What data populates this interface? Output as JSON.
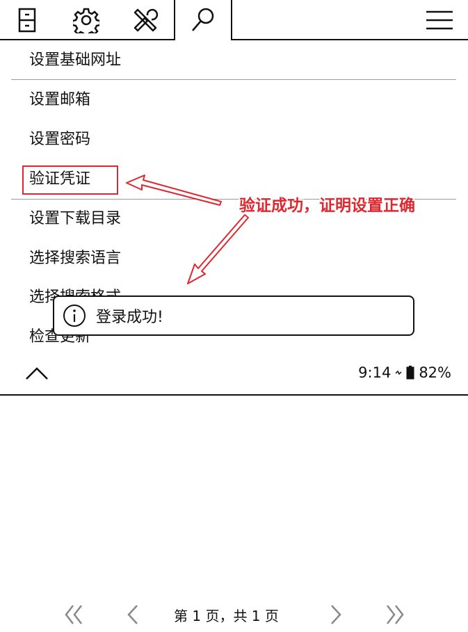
{
  "toolbar": {
    "icons": [
      "file-cabinet-icon",
      "gear-icon",
      "tools-icon",
      "search-icon",
      "hamburger-menu-icon"
    ]
  },
  "menu": {
    "items": [
      {
        "label": "设置基础网址"
      },
      {
        "label": "设置邮箱"
      },
      {
        "label": "设置密码"
      },
      {
        "label": "验证凭证"
      },
      {
        "label": "设置下载目录"
      },
      {
        "label": "选择搜索语言"
      },
      {
        "label": "选择搜索格式"
      },
      {
        "label": "检查更新"
      }
    ]
  },
  "status_bar": {
    "time": "9:14",
    "battery": "82%"
  },
  "toast": {
    "message": "登录成功!"
  },
  "annotation": {
    "text": "验证成功，证明设置正确",
    "color": "#e0262f"
  },
  "pager": {
    "info": "第 1 页，共 1 页"
  }
}
